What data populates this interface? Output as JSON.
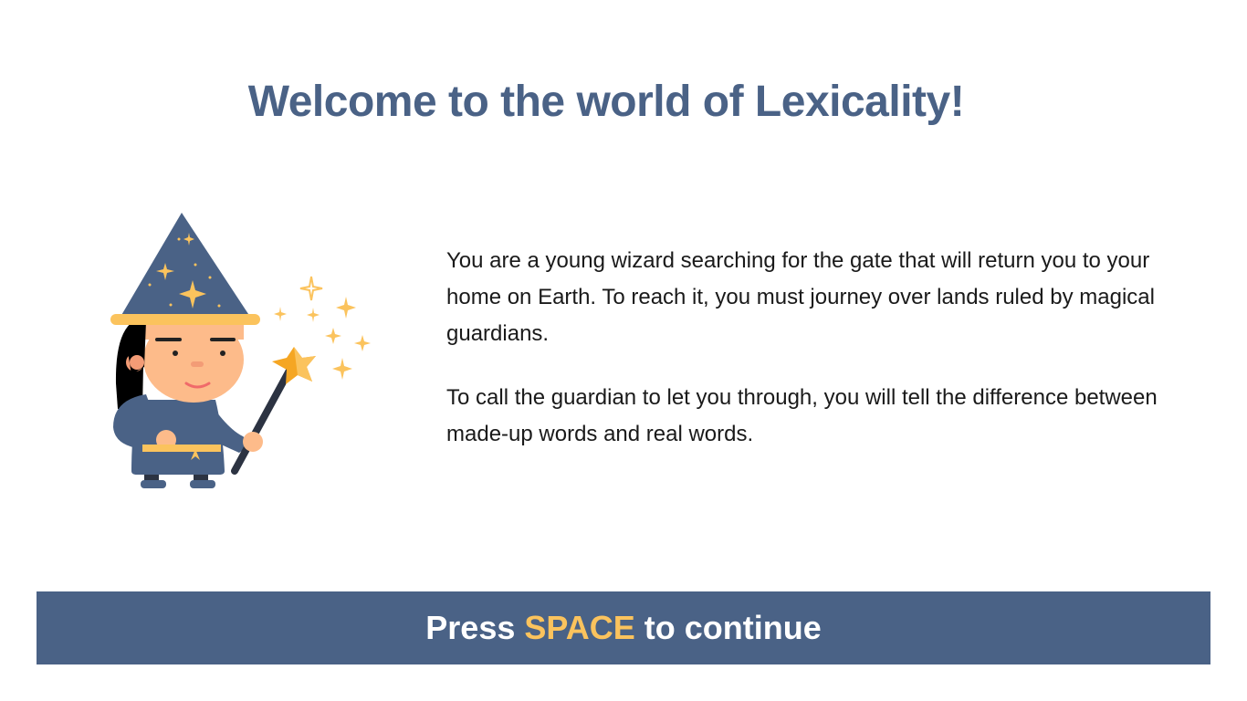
{
  "header": {
    "title": "Welcome to the world of Lexicality!"
  },
  "illustration": {
    "icon": "wizard-with-wand-icon"
  },
  "intro": {
    "paragraph_1": "You are a young wizard searching for the gate that will return you to your home on Earth. To reach it, you must journey over lands ruled by magical guardians.",
    "paragraph_2": "To call the guardian to let you through, you will tell the difference between made-up words and real words."
  },
  "continue_prompt": {
    "prefix": "Press",
    "key": "SPACE",
    "suffix": "to continue"
  },
  "colors": {
    "primary": "#4a6286",
    "accent": "#fbc35d",
    "text": "#1a1a1a",
    "background": "#ffffff"
  }
}
